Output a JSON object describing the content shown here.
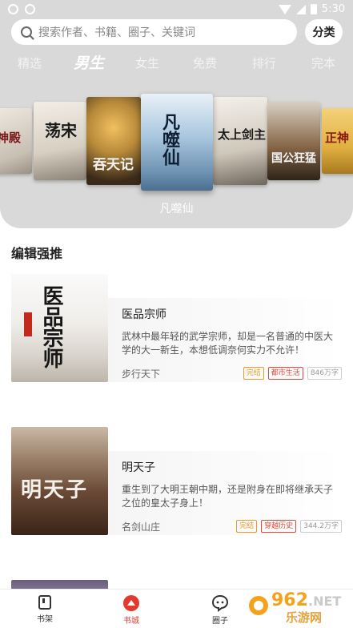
{
  "status": {
    "time": "5:30"
  },
  "search": {
    "placeholder": "搜索作者、书籍、圈子、关键词",
    "category_label": "分类"
  },
  "tabs": [
    {
      "label": "精选",
      "active": false
    },
    {
      "label": "男生",
      "active": true
    },
    {
      "label": "女生",
      "active": false
    },
    {
      "label": "免费",
      "active": false
    },
    {
      "label": "排行",
      "active": false
    },
    {
      "label": "完本",
      "active": false
    }
  ],
  "carousel": {
    "covers": [
      {
        "title": "神殿",
        "tint": "#c9c0b4"
      },
      {
        "title": "荡宋",
        "tint": "#d7cfc2"
      },
      {
        "title": "吞天记",
        "tint": "#b88a3a"
      },
      {
        "title": "凡噬仙",
        "tint": "#7fa8c8"
      },
      {
        "title": "太上剑主",
        "tint": "#cfc7ba"
      },
      {
        "title": "国公狂猛",
        "tint": "#8a6a4a"
      },
      {
        "title": "正神",
        "tint": "#e0b040"
      }
    ],
    "featured_name": "凡噬仙"
  },
  "section": {
    "title": "编辑强推"
  },
  "books": [
    {
      "title": "医品宗师",
      "cover_text": "医品宗师",
      "description": "武林中最年轻的武学宗师，却是一名普通的中医大学的大一新生，本想低调奈何实力不允许！",
      "author": "步行天下",
      "tags": {
        "status": "完结",
        "genre": "都市生活",
        "words": "846万字"
      }
    },
    {
      "title": "明天子",
      "cover_text": "明天子",
      "description": "重生到了大明王朝中期，还是附身在即将继承天子之位的皇太子身上！",
      "author": "名剑山庄",
      "tags": {
        "status": "完结",
        "genre": "穿越历史",
        "words": "344.2万字"
      }
    }
  ],
  "nav": [
    {
      "label": "书架",
      "icon": "bookshelf-icon",
      "active": false
    },
    {
      "label": "书城",
      "icon": "bookstore-icon",
      "active": true
    },
    {
      "label": "圈子",
      "icon": "chat-bubble-icon",
      "active": false
    }
  ],
  "watermark": {
    "text_top": "962",
    "text_suffix": ".NET",
    "text_bottom": "乐游网"
  },
  "colors": {
    "accent": "#e23b2e",
    "header_gray": "#d9d9d9",
    "tag_orange": "#e89a2a",
    "tag_red": "#e0483a"
  }
}
